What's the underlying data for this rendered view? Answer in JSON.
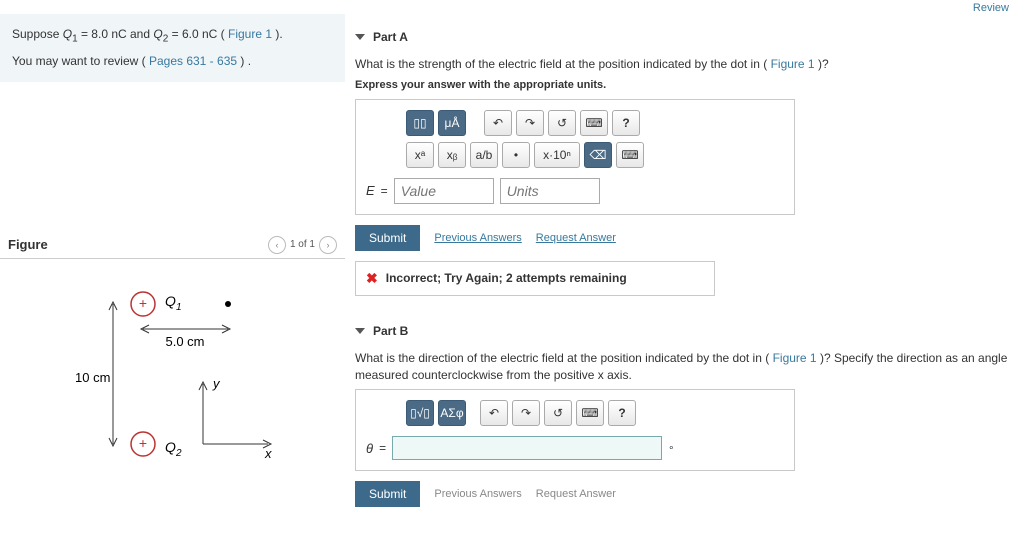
{
  "top": {
    "review": "Review"
  },
  "intro": {
    "line1_prefix": "Suppose ",
    "q1_sym": "Q",
    "q1_sub": "1",
    "q1_val": " = 8.0 nC and ",
    "q2_sym": "Q",
    "q2_sub": "2",
    "q2_val": " = 6.0 nC (",
    "fig_link": "Figure 1",
    "line1_suffix": ").",
    "line2_prefix": "You may want to review (",
    "pages_link": "Pages 631 - 635",
    "line2_suffix": ") ."
  },
  "figure": {
    "title": "Figure",
    "pager": "1 of 1",
    "label_q1": "Q₁",
    "label_q2": "Q₂",
    "dist_top": "5.0 cm",
    "dist_left": "10 cm",
    "axis_y": "y",
    "axis_x": "x",
    "plus": "+"
  },
  "partA": {
    "title": "Part A",
    "question_prefix": "What is the strength of the electric field at the position indicated by the dot in (",
    "fig_link": "Figure 1",
    "question_suffix": ")?",
    "instr": "Express your answer with the appropriate units.",
    "toolbar": {
      "templates": "▯▯",
      "units": "μÅ",
      "undo": "↶",
      "redo": "↷",
      "reset": "↺",
      "keyboard": "⌨",
      "help": "?",
      "xa": "xᵃ",
      "xb": "xᵦ",
      "frac": "a/b",
      "dot": "•",
      "sci": "x·10ⁿ",
      "back": "⌫",
      "key2": "⌨"
    },
    "var": "E",
    "eq": "=",
    "value_ph": "Value",
    "units_ph": "Units",
    "submit": "Submit",
    "prev": "Previous Answers",
    "req": "Request Answer",
    "feedback": "Incorrect; Try Again; 2 attempts remaining"
  },
  "partB": {
    "title": "Part B",
    "question_prefix": "What is the direction of the electric field at the position indicated by the dot in (",
    "fig_link": "Figure 1",
    "question_suffix": ")? Specify the direction as an angle measured counterclockwise from the positive x axis.",
    "toolbar": {
      "templates": "▯√▯",
      "greek": "ΑΣφ",
      "undo": "↶",
      "redo": "↷",
      "reset": "↺",
      "keyboard": "⌨",
      "help": "?"
    },
    "var": "θ",
    "eq": "=",
    "deg": "∘",
    "submit": "Submit",
    "prev": "Previous Answers",
    "req": "Request Answer"
  }
}
